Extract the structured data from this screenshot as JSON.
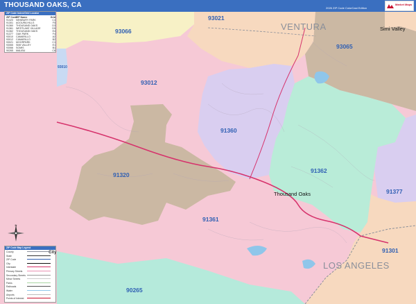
{
  "header": {
    "title": "THOUSAND OAKS, CA",
    "edition": "2026 ZIP Code ColorCast Edition",
    "logo_text": "Market Maps"
  },
  "zip_index": {
    "title": "ZIP Code Index/Grid Locator",
    "header": {
      "zip": "ZIP Code",
      "city": "ZIP Name",
      "grid": "Grid"
    },
    "rows": [
      {
        "zip": "91320",
        "city": "NEWBURY PARK",
        "grid": "C4"
      },
      {
        "zip": "91301",
        "city": "AGOURA HILLS",
        "grid": "F5"
      },
      {
        "zip": "91360",
        "city": "THOUSAND OAKS",
        "grid": "D3"
      },
      {
        "zip": "91361",
        "city": "WESTLAKE VILLAGE",
        "grid": "D5"
      },
      {
        "zip": "91362",
        "city": "THOUSAND OAKS",
        "grid": "E4"
      },
      {
        "zip": "91377",
        "city": "OAK PARK",
        "grid": "F4"
      },
      {
        "zip": "93010",
        "city": "CAMARILLO",
        "grid": "A2"
      },
      {
        "zip": "93012",
        "city": "CAMARILLO",
        "grid": "B2"
      },
      {
        "zip": "93021",
        "city": "MOORPARK",
        "grid": "C1"
      },
      {
        "zip": "93065",
        "city": "SIMI VALLEY",
        "grid": "E1"
      },
      {
        "zip": "93066",
        "city": "SOMIS",
        "grid": "B1"
      },
      {
        "zip": "90265",
        "city": "MALIBU",
        "grid": "C6"
      }
    ]
  },
  "legend": {
    "title": "ZIP Code Map Legend",
    "city_sample": "City",
    "items": [
      "County",
      "State",
      "ZIP Code",
      "City",
      "Interstate",
      "Primary Streets",
      "Secondary Streets",
      "Minor Streets",
      "Parks",
      "Railroads",
      "Water",
      "Airports",
      "Points of Interest"
    ]
  },
  "map": {
    "zip_labels": [
      "93021",
      "93066",
      "93065",
      "93012",
      "91360",
      "91362",
      "91320",
      "91377",
      "91361",
      "91301",
      "90265",
      "93010"
    ],
    "county_labels": [
      "VENTURA",
      "LOS ANGELES"
    ],
    "city_labels": [
      "Simi Valley",
      "Thousand Oaks"
    ],
    "compass_letter": "N"
  },
  "colors": {
    "header": "#3a6fc0",
    "zip_label": "#2f5fb3",
    "pink": "#f6c9d6",
    "tan": "#cbb8a3",
    "lavender": "#d9cef0",
    "mint": "#b9ecd8",
    "peach": "#f7d9bf",
    "yellow": "#f7f1c6",
    "blue": "#c8daf3",
    "teal": "#b5eadb",
    "highway": "#d6336c"
  }
}
